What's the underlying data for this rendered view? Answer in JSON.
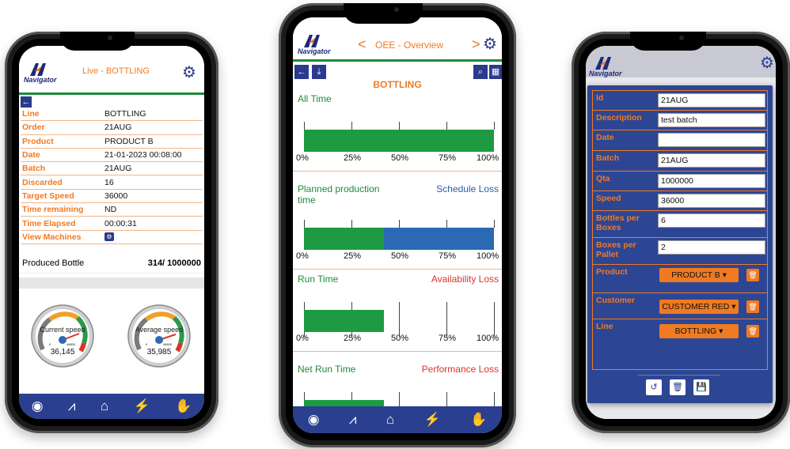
{
  "phone1": {
    "logo": "Navigator",
    "title": "Live - BOTTLING",
    "back": "←",
    "rows": [
      {
        "k": "Line",
        "v": "BOTTLING"
      },
      {
        "k": "Order",
        "v": "21AUG"
      },
      {
        "k": "Product",
        "v": "PRODUCT B"
      },
      {
        "k": "Date",
        "v": "21-01-2023 00:08:00"
      },
      {
        "k": "Batch",
        "v": "21AUG"
      },
      {
        "k": "Discarded",
        "v": "16"
      },
      {
        "k": "Target Speed",
        "v": "36000"
      },
      {
        "k": "Time remaining",
        "v": "ND"
      },
      {
        "k": "Time Elapsed",
        "v": "00:00:31"
      },
      {
        "k": "View Machines",
        "v": ""
      }
    ],
    "produced_label": "Produced Bottle",
    "produced_value": "314/ 1000000",
    "gauge1": {
      "label": "Current speed",
      "value": "36,145",
      "min": "0",
      "max": "46800"
    },
    "gauge2": {
      "label": "Average speed",
      "value": "35,985",
      "min": "0",
      "max": "46800"
    }
  },
  "phone2": {
    "logo": "Navigator",
    "title": "OEE - Overview",
    "prev": "<",
    "next": ">",
    "subtitle": "BOTTLING",
    "axis": [
      "0%",
      "25%",
      "50%",
      "75%",
      "100%"
    ],
    "sections": [
      {
        "left": "All Time",
        "right": "",
        "green": 1.0,
        "blue": 0
      },
      {
        "left": "Planned production time",
        "right": "Schedule Loss",
        "green": 0.42,
        "blue": 0.58
      },
      {
        "left": "Run Time",
        "right": "Availability Loss",
        "green": 0.42,
        "blue": 0
      },
      {
        "left": "Net Run Time",
        "right": "Performance Loss",
        "green": 0.42,
        "blue": 0
      }
    ]
  },
  "phone3": {
    "logo": "Navigator",
    "fields": [
      {
        "k": "Id",
        "v": "21AUG"
      },
      {
        "k": "Description",
        "v": "test batch"
      },
      {
        "k": "Date",
        "v": ""
      },
      {
        "k": "Batch",
        "v": "21AUG"
      },
      {
        "k": "Qta",
        "v": "1000000"
      },
      {
        "k": "Speed",
        "v": "36000"
      },
      {
        "k": "Bottles per Boxes",
        "v": "6"
      },
      {
        "k": "Boxes per Pallet",
        "v": "2"
      }
    ],
    "selects": [
      {
        "k": "Product",
        "v": "PRODUCT B ▾"
      },
      {
        "k": "Customer",
        "v": "CUSTOMER RED ▾"
      },
      {
        "k": "Line",
        "v": "BOTTLING ▾"
      }
    ]
  },
  "colors": {
    "accent": "#f07a22",
    "nav": "#2a3f8f",
    "green": "#1e9a43",
    "blue": "#2a6ab5"
  }
}
